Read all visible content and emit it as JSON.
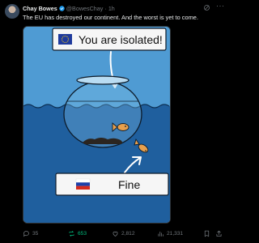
{
  "author": {
    "name": "Chay Bowes",
    "handle": "@BowesChay",
    "separator": "·",
    "time": "1h"
  },
  "tweet": {
    "text": "The EU has destroyed our continent. And the worst is yet to come."
  },
  "meme": {
    "top_label": "You are isolated!",
    "bottom_label": "Fine"
  },
  "actions": {
    "replies": "35",
    "reposts": "653",
    "likes": "2,812",
    "views": "21,331"
  },
  "icons": [
    "verified-badge-icon",
    "grok-icon",
    "more-icon",
    "reply-icon",
    "repost-icon",
    "like-icon",
    "views-icon",
    "bookmark-icon",
    "share-icon"
  ],
  "colors": {
    "background": "#000000",
    "text": "#e7e9ea",
    "muted": "#71767b",
    "verified": "#1d9bf0",
    "repost_active": "#00ba7c",
    "sea": "#4a97d0"
  }
}
